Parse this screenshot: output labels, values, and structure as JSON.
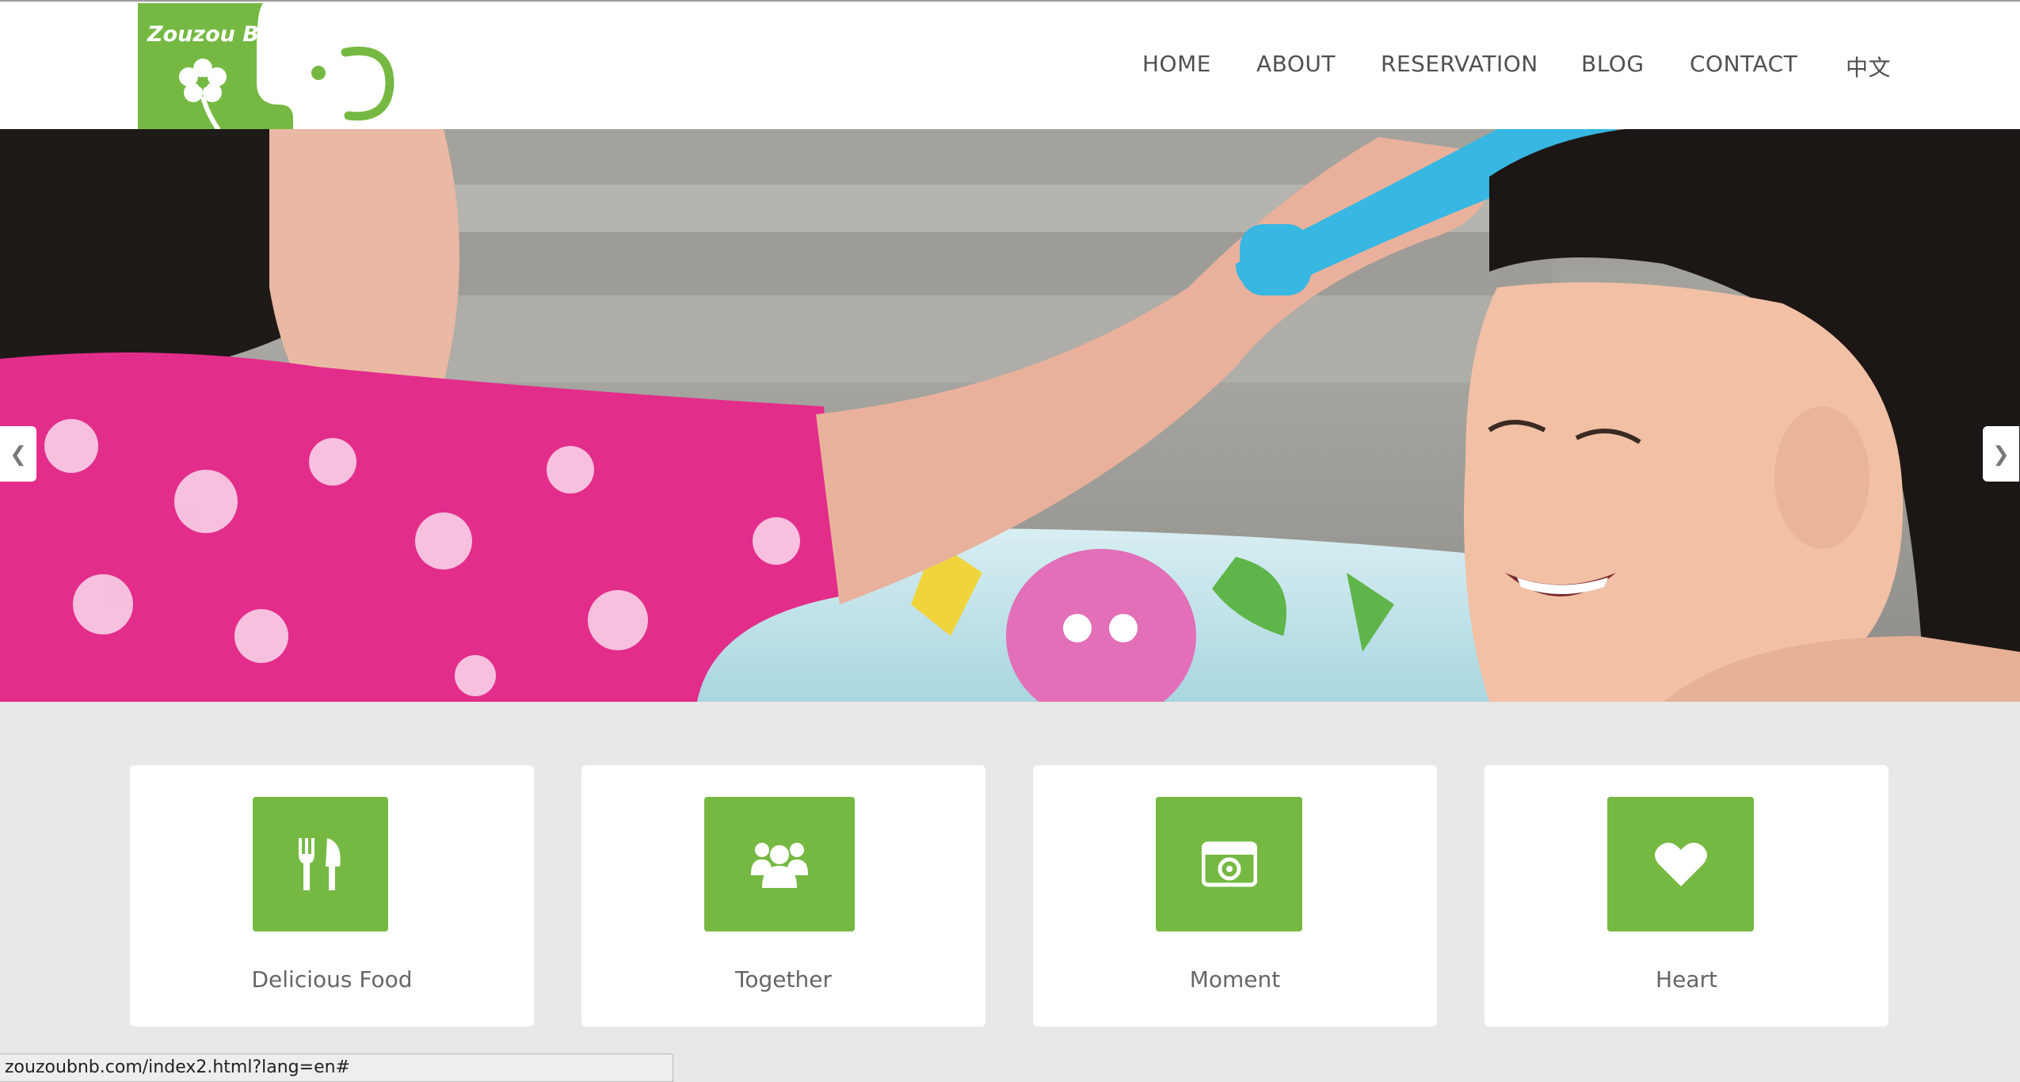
{
  "brand": {
    "logo_text": "Zouzou B&B"
  },
  "nav": {
    "items": [
      {
        "label": "HOME"
      },
      {
        "label": "ABOUT"
      },
      {
        "label": "RESERVATION"
      },
      {
        "label": "BLOG"
      },
      {
        "label": "CONTACT"
      },
      {
        "label": "中文"
      }
    ]
  },
  "hero": {
    "prev_icon": "chevron-left-icon",
    "next_icon": "chevron-right-icon"
  },
  "features": [
    {
      "label": "Delicious Food",
      "icon": "fork-knife-icon"
    },
    {
      "label": "Together",
      "icon": "group-icon"
    },
    {
      "label": "Moment",
      "icon": "camera-icon"
    },
    {
      "label": "Heart",
      "icon": "heart-icon"
    }
  ],
  "status_bar": {
    "url": "zouzoubnb.com/index2.html?lang=en#"
  },
  "colors": {
    "accent": "#75b942",
    "background": "#e8e8e8",
    "nav_text": "#505050"
  }
}
